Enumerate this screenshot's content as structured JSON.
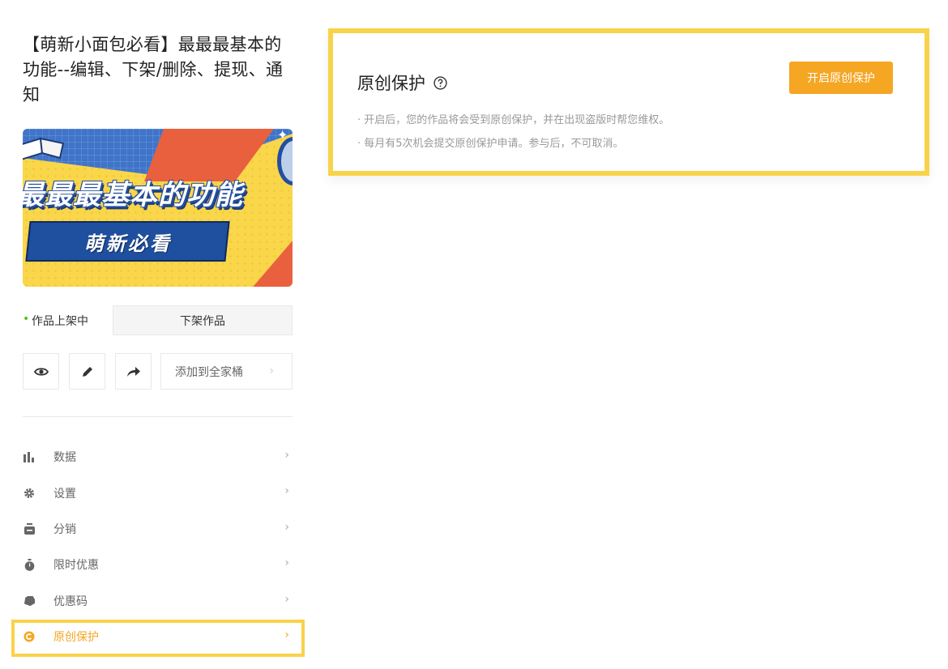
{
  "course": {
    "title": "【萌新小面包必看】最最最基本的功能--编辑、下架/删除、提现、通知",
    "cover": {
      "headline": "最最最基本的功能",
      "banner": "萌新必看"
    },
    "status_text": "作品上架中",
    "takedown_label": "下架作品",
    "add_family_label": "添加到全家桶",
    "add_family_chevron": "›"
  },
  "menu": {
    "items": [
      {
        "label": "数据",
        "icon": "bar-chart-icon"
      },
      {
        "label": "设置",
        "icon": "gear-icon"
      },
      {
        "label": "分销",
        "icon": "money-bag-icon"
      },
      {
        "label": "限时优惠",
        "icon": "stopwatch-icon"
      },
      {
        "label": "优惠码",
        "icon": "tag-icon"
      },
      {
        "label": "原创保护",
        "icon": "copyright-icon",
        "active": true
      }
    ],
    "chevron": "›"
  },
  "panel": {
    "title": "原创保护",
    "open_button": "开启原创保护",
    "note1": "· 开启后，您的作品将会受到原创保护，并在出现盗版时帮您维权。",
    "note2": "· 每月有5次机会提交原创保护申请。参与后，不可取消。"
  },
  "colors": {
    "accent": "#f5a623",
    "highlight": "#f8d34a",
    "status_green": "#52c41a"
  }
}
